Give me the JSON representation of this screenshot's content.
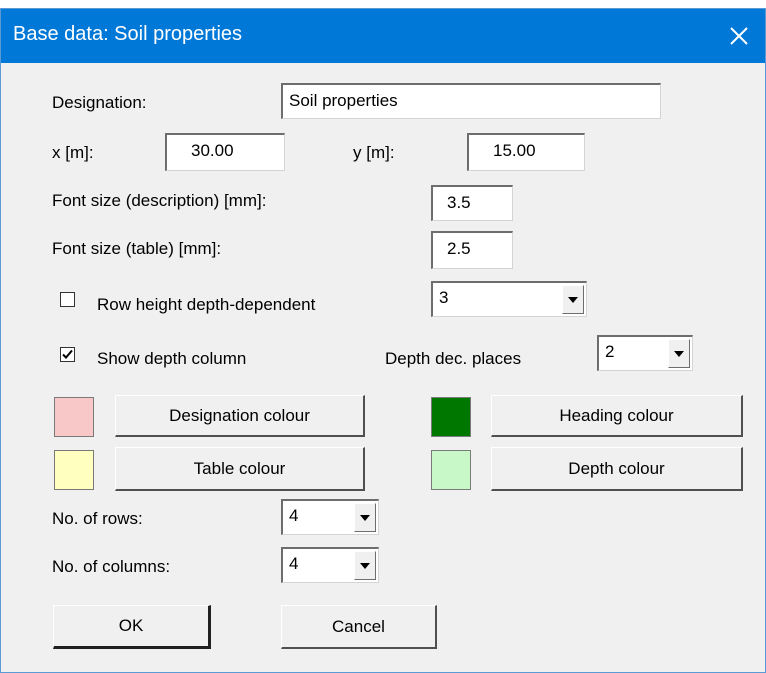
{
  "window": {
    "title": "Base data: Soil properties"
  },
  "designation": {
    "label": "Designation:",
    "value": "Soil properties"
  },
  "x": {
    "label": "x [m]:",
    "value": "30.00"
  },
  "y": {
    "label": "y [m]:",
    "value": "15.00"
  },
  "font_size_description": {
    "label": "Font size (description) [mm]:",
    "value": "3.5"
  },
  "font_size_table": {
    "label": "Font size (table) [mm]:",
    "value": "2.5"
  },
  "row_height": {
    "label": "Row height depth-dependent",
    "checked": false,
    "value": "3"
  },
  "depth_column": {
    "label": "Show depth column",
    "checked": true
  },
  "depth_dec_places": {
    "label": "Depth dec. places",
    "value": "2"
  },
  "colours": {
    "designation": {
      "label": "Designation colour",
      "color": "#f8c8c8"
    },
    "heading": {
      "label": "Heading colour",
      "color": "#007800"
    },
    "table": {
      "label": "Table colour",
      "color": "#ffffc0"
    },
    "depth": {
      "label": "Depth colour",
      "color": "#c8f8c8"
    }
  },
  "rows": {
    "label": "No. of rows:",
    "value": "4"
  },
  "columns": {
    "label": "No. of columns:",
    "value": "4"
  },
  "buttons": {
    "ok": "OK",
    "cancel": "Cancel"
  }
}
